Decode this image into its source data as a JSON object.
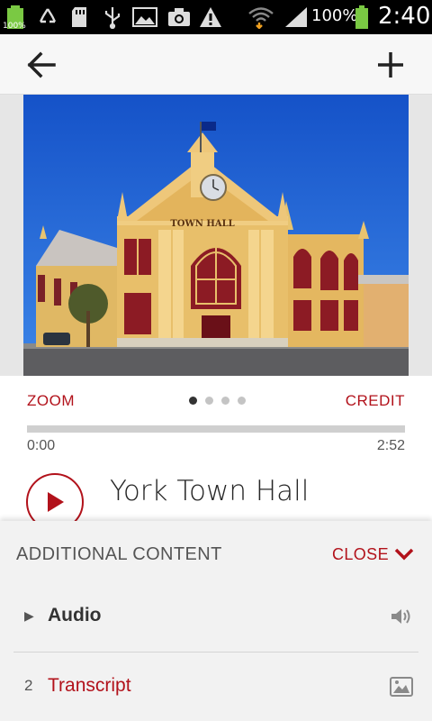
{
  "status_bar": {
    "battery_small_label": "100%",
    "battery_percent": "100%",
    "time": "2:40",
    "icons": [
      "battery-full-icon",
      "recycle-icon",
      "sd-card-icon",
      "usb-icon",
      "image-icon",
      "camera-icon",
      "warning-icon",
      "wifi-icon",
      "signal-icon",
      "battery-icon"
    ]
  },
  "app_bar": {
    "back_icon": "arrow-left-icon",
    "add_icon": "plus-icon"
  },
  "photo": {
    "building_sign": "TOWN HALL"
  },
  "media": {
    "zoom_label": "ZOOM",
    "credit_label": "CREDIT",
    "carousel": {
      "count": 4,
      "active": 1
    },
    "progress": 0,
    "time_current": "0:00",
    "time_total": "2:52",
    "title": "York Town Hall"
  },
  "additional": {
    "heading": "ADDITIONAL CONTENT",
    "close_label": "CLOSE",
    "items": [
      {
        "marker": "▶",
        "label": "Audio",
        "icon": "speaker-icon",
        "color": "#333333"
      },
      {
        "marker": "2",
        "label": "Transcript",
        "icon": "image-icon",
        "color": "#b2121b"
      }
    ]
  },
  "colors": {
    "accent": "#b2121b",
    "sky": "#1a5fd0",
    "status_green": "#7ac943"
  }
}
